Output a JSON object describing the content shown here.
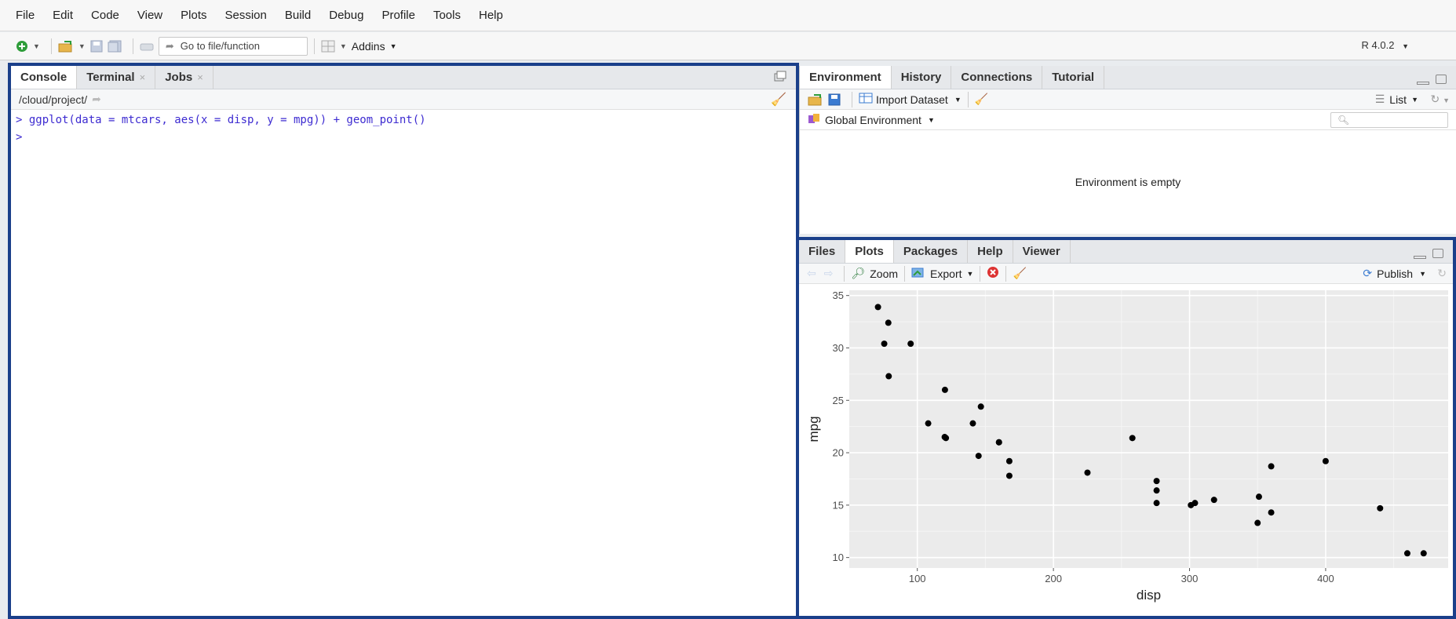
{
  "menu": [
    "File",
    "Edit",
    "Code",
    "View",
    "Plots",
    "Session",
    "Build",
    "Debug",
    "Profile",
    "Tools",
    "Help"
  ],
  "toolbar": {
    "goto_placeholder": "Go to file/function",
    "addins_label": "Addins",
    "r_version": "R 4.0.2"
  },
  "console": {
    "tabs": [
      {
        "label": "Console",
        "closable": false
      },
      {
        "label": "Terminal",
        "closable": true
      },
      {
        "label": "Jobs",
        "closable": true
      }
    ],
    "path": "/cloud/project/",
    "lines": [
      "> ggplot(data = mtcars, aes(x = disp, y = mpg)) + geom_point()",
      ">"
    ]
  },
  "environment": {
    "tabs": [
      "Environment",
      "History",
      "Connections",
      "Tutorial"
    ],
    "import_label": "Import Dataset",
    "list_label": "List",
    "scope_label": "Global Environment",
    "empty_message": "Environment is empty"
  },
  "files": {
    "tabs": [
      "Files",
      "Plots",
      "Packages",
      "Help",
      "Viewer"
    ],
    "zoom_label": "Zoom",
    "export_label": "Export",
    "publish_label": "Publish"
  },
  "colors": {
    "pane_border": "#1a3f8a",
    "console_text": "#3d2bd1",
    "plot_bg": "#ebebeb"
  },
  "chart_data": {
    "type": "scatter",
    "xlabel": "disp",
    "ylabel": "mpg",
    "xlim": [
      50,
      490
    ],
    "ylim": [
      9,
      35.5
    ],
    "xticks": [
      100,
      200,
      300,
      400
    ],
    "yticks": [
      10,
      15,
      20,
      25,
      30,
      35
    ],
    "grid": true,
    "points": [
      [
        160,
        21.0
      ],
      [
        160,
        21.0
      ],
      [
        108,
        22.8
      ],
      [
        258,
        21.4
      ],
      [
        360,
        18.7
      ],
      [
        225,
        18.1
      ],
      [
        360,
        14.3
      ],
      [
        146.7,
        24.4
      ],
      [
        140.8,
        22.8
      ],
      [
        167.6,
        19.2
      ],
      [
        167.6,
        17.8
      ],
      [
        275.8,
        16.4
      ],
      [
        275.8,
        17.3
      ],
      [
        275.8,
        15.2
      ],
      [
        472,
        10.4
      ],
      [
        460,
        10.4
      ],
      [
        440,
        14.7
      ],
      [
        78.7,
        32.4
      ],
      [
        75.7,
        30.4
      ],
      [
        71.1,
        33.9
      ],
      [
        120.1,
        21.5
      ],
      [
        318,
        15.5
      ],
      [
        304,
        15.2
      ],
      [
        350,
        13.3
      ],
      [
        400,
        19.2
      ],
      [
        79,
        27.3
      ],
      [
        120.3,
        26.0
      ],
      [
        95.1,
        30.4
      ],
      [
        351,
        15.8
      ],
      [
        145,
        19.7
      ],
      [
        301,
        15.0
      ],
      [
        121,
        21.4
      ]
    ]
  }
}
